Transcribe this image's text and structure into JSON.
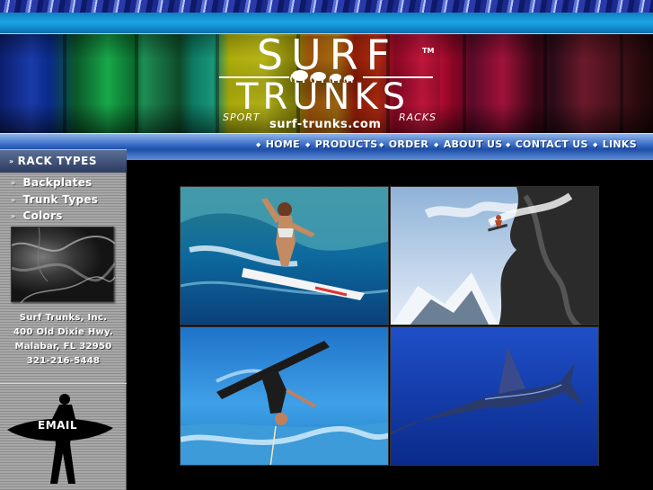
{
  "header": {
    "logo_top": "SURF",
    "logo_bottom": "TRUNKS",
    "trademark": "TM",
    "tagline_left": "SPORT",
    "tagline_right": "RACKS",
    "url": "surf-trunks.com"
  },
  "nav": {
    "items": [
      {
        "label": "HOME"
      },
      {
        "label": "PRODUCTS"
      },
      {
        "label": "ORDER"
      },
      {
        "label": "ABOUT US"
      },
      {
        "label": "CONTACT US"
      },
      {
        "label": "LINKS"
      }
    ]
  },
  "sidebar": {
    "title": "RACK TYPES",
    "links": [
      {
        "label": "Backplates"
      },
      {
        "label": "Trunk Types"
      },
      {
        "label": "Colors"
      }
    ],
    "address": {
      "name": "Surf Trunks, Inc.",
      "street": "400 Old Dixie Hwy.",
      "city": "Malabar, FL 32950",
      "phone": "321-216-5448"
    },
    "email_label": "EMAIL"
  },
  "photos": [
    {
      "subject": "surfer"
    },
    {
      "subject": "snowboarder"
    },
    {
      "subject": "wakeboarder"
    },
    {
      "subject": "marlin"
    }
  ],
  "colors": {
    "nav_text": "#ffffff",
    "background": "#000000",
    "band": "#1aa6e6"
  }
}
